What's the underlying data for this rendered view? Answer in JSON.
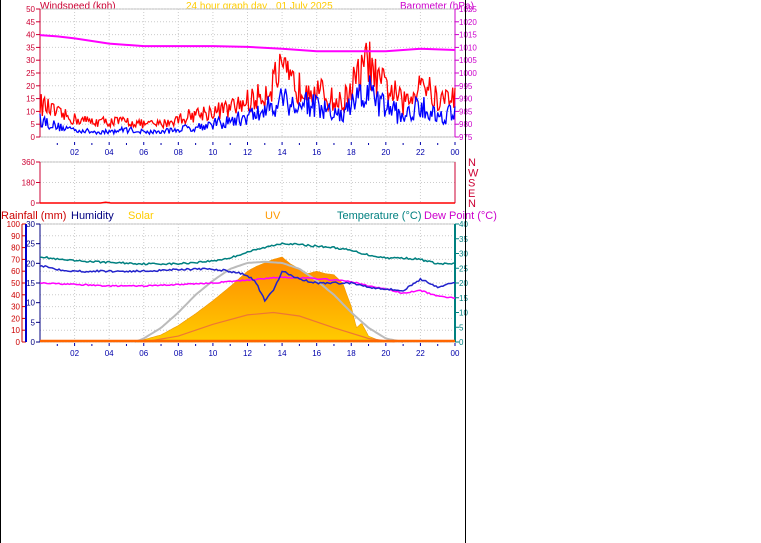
{
  "header": {
    "windspeed_label": "Windspeed (kph)",
    "title": "24 hour graph day",
    "date": "01 July 2025",
    "barometer_label": "Barometer (hPa)"
  },
  "lower_header": {
    "rainfall_label": "Rainfall (mm)",
    "humidity_label": "Humidity",
    "solar_label": "Solar",
    "uv_label": "UV",
    "temperature_label": "Temperature (°C)",
    "dewpoint_label": "Dew Point (°C)"
  },
  "colors": {
    "gust": "#ff0000",
    "wind": "#0000ff",
    "barometer": "#ff00ff",
    "rainfall": "#cc0000",
    "humidity": "#000080",
    "solar": "#ffcc00",
    "uv": "#ff9900",
    "temperature": "#008080",
    "dewpoint": "#ff00ff",
    "axis_left": "#cc0033",
    "axis_right_top": "#cc00cc",
    "axis_right_bottom": "#008080",
    "time_axis": "#0000aa",
    "grid": "#cccccc"
  },
  "chart_data": [
    {
      "type": "line",
      "title": "24 hour graph day",
      "x_ticks": [
        "02",
        "04",
        "06",
        "08",
        "10",
        "12",
        "14",
        "16",
        "18",
        "20",
        "22",
        "00"
      ],
      "y_left": {
        "label": "Windspeed (kph)",
        "ticks": [
          "0",
          "5",
          "10",
          "15",
          "20",
          "25",
          "30",
          "35",
          "40",
          "45",
          "50"
        ],
        "ylim": [
          0,
          50
        ]
      },
      "y_right": {
        "label": "Barometer (hPa)",
        "ticks": [
          "975",
          "980",
          "985",
          "990",
          "995",
          "1000",
          "1005",
          "1010",
          "1015",
          "1020",
          "1025"
        ],
        "ylim": [
          975,
          1025
        ]
      },
      "grid": true,
      "series": [
        {
          "name": "Barometer (hPa)",
          "axis": "right",
          "x": [
            0,
            1,
            2,
            4,
            6,
            8,
            10,
            12,
            14,
            16,
            18,
            20,
            22,
            24
          ],
          "y": [
            1014.8,
            1014.3,
            1013.5,
            1011.5,
            1010.5,
            1010.5,
            1010.5,
            1010.2,
            1009.5,
            1008.5,
            1008.5,
            1008.5,
            1009.5,
            1009.0
          ]
        },
        {
          "name": "Wind gust (kph)",
          "axis": "left",
          "x": [
            0,
            1,
            2,
            3,
            4,
            5,
            6,
            7,
            8,
            9,
            10,
            11,
            12,
            12.5,
            13,
            13.5,
            14,
            14.5,
            15,
            15.5,
            16,
            16.5,
            17,
            17.5,
            18,
            18.5,
            19,
            19.5,
            20,
            20.5,
            21,
            21.5,
            22,
            22.5,
            23,
            23.5,
            24
          ],
          "y": [
            13,
            9,
            7,
            6,
            6,
            6,
            5,
            5,
            7,
            9,
            10,
            11,
            14,
            15,
            17,
            22,
            25,
            21,
            19,
            22,
            18,
            16,
            14,
            13,
            20,
            24,
            30,
            21,
            20,
            17,
            13,
            15,
            25,
            18,
            14,
            15,
            17
          ]
        },
        {
          "name": "Wind speed (kph)",
          "axis": "left",
          "x": [
            0,
            1,
            2,
            3,
            4,
            5,
            6,
            7,
            8,
            9,
            10,
            11,
            12,
            12.5,
            13,
            13.5,
            14,
            14.5,
            15,
            15.5,
            16,
            16.5,
            17,
            17.5,
            18,
            18.5,
            19,
            19.5,
            20,
            20.5,
            21,
            21.5,
            22,
            22.5,
            23,
            23.5,
            24
          ],
          "y": [
            7,
            4,
            3,
            2,
            2,
            3,
            2,
            2,
            3,
            4,
            5,
            6,
            8,
            9,
            10,
            13,
            16,
            13,
            12,
            14,
            11,
            10,
            9,
            8,
            12,
            15,
            18,
            13,
            12,
            10,
            8,
            9,
            14,
            10,
            8,
            9,
            10
          ]
        }
      ]
    },
    {
      "type": "line",
      "x_ticks": [
        "02",
        "04",
        "06",
        "08",
        "10",
        "12",
        "14",
        "16",
        "18",
        "20",
        "22",
        "00"
      ],
      "y_left": {
        "ticks": [
          "0",
          "180",
          "360"
        ],
        "ylim": [
          0,
          360
        ]
      },
      "y_right": {
        "ticks": [
          "N",
          "W",
          "S",
          "E",
          "N"
        ]
      },
      "grid": true,
      "series": [
        {
          "name": "Wind direction",
          "x": [
            0,
            3.5,
            3.8,
            4.1,
            24
          ],
          "y": [
            0,
            0,
            6,
            0,
            0
          ]
        }
      ]
    },
    {
      "type": "area",
      "x_ticks": [
        "02",
        "04",
        "06",
        "08",
        "10",
        "12",
        "14",
        "16",
        "18",
        "20",
        "22",
        "00"
      ],
      "y_left_rain": {
        "label": "Rainfall (mm)",
        "ticks": [
          "0",
          "10",
          "20",
          "30",
          "40",
          "50",
          "60",
          "70",
          "80",
          "90",
          "100"
        ],
        "ylim": [
          0,
          100
        ]
      },
      "y_left_humidity": {
        "label": "Humidity",
        "ticks": [
          "0",
          "5",
          "10",
          "15",
          "20",
          "25",
          "30"
        ],
        "ylim": [
          0,
          30
        ]
      },
      "y_right": {
        "label": "Temperature (°C)",
        "ticks": [
          "0",
          "5",
          "10",
          "15",
          "20",
          "25",
          "30",
          "35",
          "40"
        ],
        "ylim": [
          0,
          40
        ]
      },
      "grid": true,
      "series": [
        {
          "name": "Temperature (°C)",
          "axis": "right",
          "x": [
            0,
            1,
            2,
            4,
            6,
            8,
            10,
            11,
            12,
            13,
            14,
            15,
            16,
            17,
            18,
            19,
            20,
            21,
            22,
            23,
            24
          ],
          "y": [
            29,
            28,
            27.5,
            27,
            26.5,
            26.5,
            27.5,
            28.5,
            30.5,
            32,
            33.5,
            33,
            32.5,
            32,
            31,
            29.5,
            28.5,
            28.5,
            28,
            26.5,
            26.5
          ]
        },
        {
          "name": "Humidity",
          "axis": "left_humidity",
          "x": [
            0,
            1,
            2,
            4,
            6,
            8,
            10,
            11,
            12,
            12.5,
            13,
            13.5,
            14,
            15,
            16,
            17,
            18,
            19,
            20,
            21,
            22,
            23,
            24
          ],
          "y": [
            19.5,
            18.5,
            18,
            18,
            18,
            18.5,
            18.5,
            18,
            17,
            15,
            10.5,
            13,
            18,
            16,
            15,
            15,
            15,
            14,
            13.5,
            13,
            16,
            14,
            15
          ]
        },
        {
          "name": "Dew Point (°C)",
          "axis": "right",
          "x": [
            0,
            2,
            4,
            6,
            8,
            10,
            12,
            13,
            14,
            16,
            18,
            19,
            20,
            21,
            22,
            23,
            24
          ],
          "y": [
            20,
            19.5,
            19,
            19,
            19.5,
            20,
            21,
            21.5,
            22,
            21.5,
            20.5,
            19,
            18,
            16.5,
            17.5,
            15.5,
            15
          ]
        },
        {
          "name": "Solar",
          "axis": "left_rain",
          "x": [
            5.5,
            6,
            7,
            8,
            9,
            10,
            11,
            12,
            12.5,
            13,
            13.5,
            14,
            14.5,
            15,
            15.5,
            16,
            16.5,
            17,
            17.5,
            18,
            18.3,
            18.6,
            19,
            19.5,
            20,
            20.5
          ],
          "y": [
            0,
            2,
            6,
            14,
            24,
            35,
            47,
            60,
            64,
            67,
            70,
            72,
            66,
            62,
            58,
            60,
            58,
            57,
            50,
            30,
            12,
            16,
            5,
            2,
            1,
            0
          ]
        },
        {
          "name": "Solar max",
          "axis": "left_rain",
          "x": [
            5.5,
            6,
            7,
            8,
            9,
            10,
            11,
            12,
            13,
            14,
            15,
            16,
            17,
            18,
            19,
            20,
            21
          ],
          "y": [
            0,
            3,
            12,
            25,
            40,
            52,
            62,
            67,
            68,
            67,
            62,
            52,
            40,
            25,
            12,
            3,
            0
          ]
        },
        {
          "name": "UV",
          "axis": "left_rain",
          "x": [
            6,
            8,
            10,
            12,
            13.5,
            15,
            17,
            19,
            20.5
          ],
          "y": [
            0,
            5,
            15,
            23,
            25,
            22,
            12,
            3,
            0
          ]
        },
        {
          "name": "Rainfall (mm)",
          "axis": "left_rain",
          "x": [
            0,
            24
          ],
          "y": [
            0,
            0
          ]
        }
      ]
    }
  ]
}
